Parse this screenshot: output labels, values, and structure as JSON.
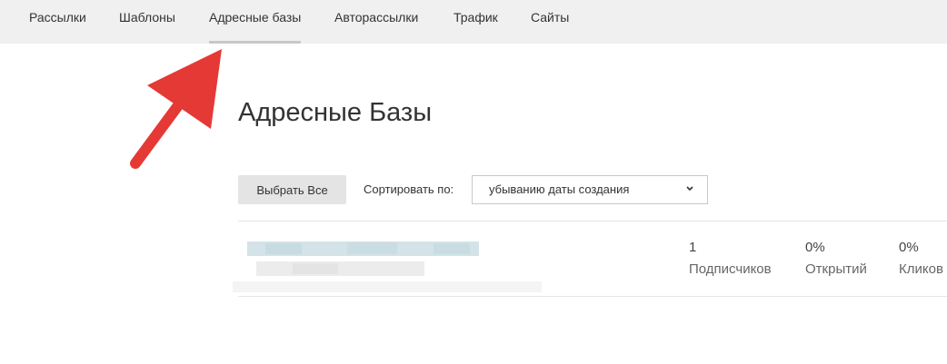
{
  "nav": {
    "items": [
      {
        "label": "Рассылки"
      },
      {
        "label": "Шаблоны"
      },
      {
        "label": "Адресные базы"
      },
      {
        "label": "Авторассылки"
      },
      {
        "label": "Трафик"
      },
      {
        "label": "Сайты"
      }
    ],
    "active_index": 2
  },
  "page": {
    "title": "Адресные Базы"
  },
  "toolbar": {
    "select_all_label": "Выбрать Все",
    "sort_label": "Сортировать по:",
    "sort_value": "убыванию даты создания"
  },
  "list": {
    "items": [
      {
        "subscribers": "1",
        "subscribers_label": "Подписчиков",
        "opens": "0%",
        "opens_label": "Открытий",
        "clicks": "0%",
        "clicks_label": "Кликов"
      }
    ]
  },
  "colors": {
    "nav_bg": "#f0f0f0",
    "active_underline": "#c8c8c8",
    "annotation_arrow": "#e53935"
  },
  "icons": {
    "sort_dropdown": "chevron-down-icon",
    "annotation": "arrow-icon"
  }
}
